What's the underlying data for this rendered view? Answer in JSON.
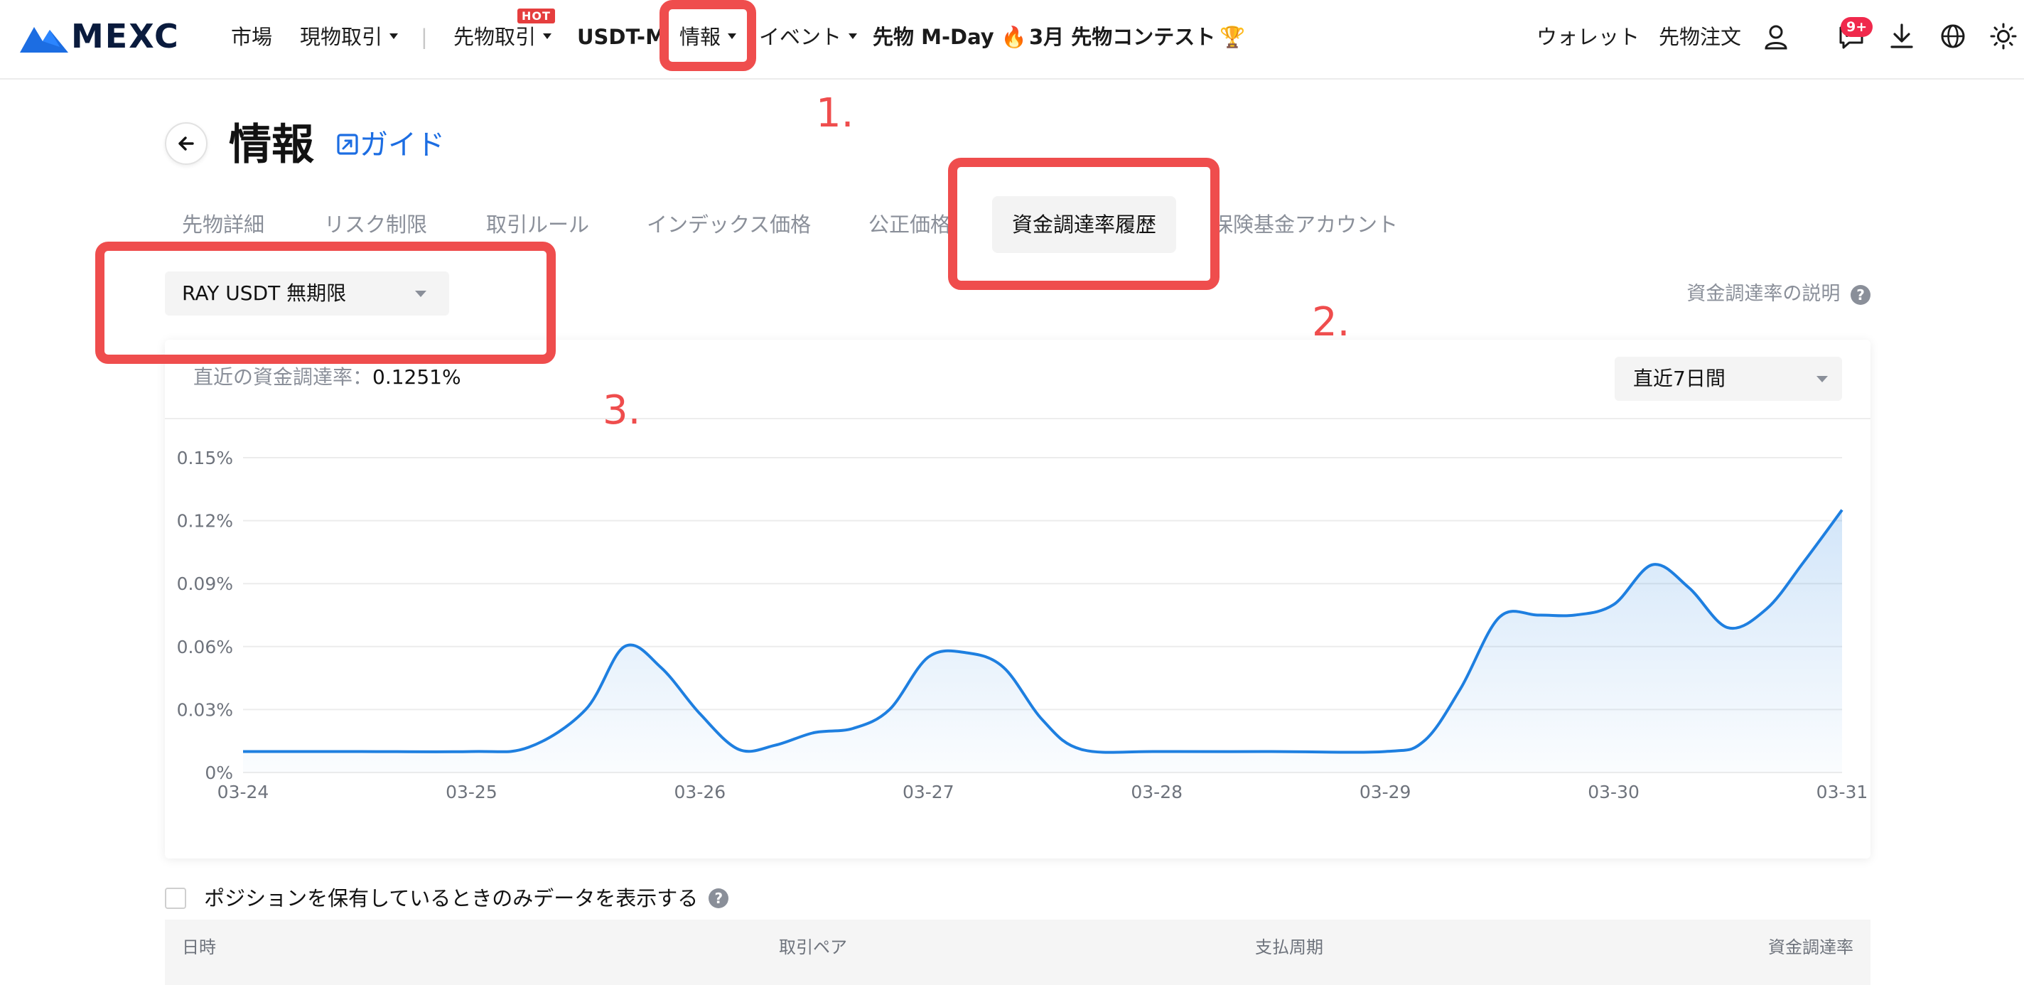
{
  "nav": {
    "logo": "MEXC",
    "items": [
      "市場",
      "現物取引",
      "先物取引",
      "USDT-M",
      "情報",
      "イベント",
      "先物 M-Day",
      "3月 先物コンテスト"
    ],
    "hot_badge": "HOT",
    "right_items": [
      "ウォレット",
      "先物注文"
    ],
    "notif_badge": "9+"
  },
  "page": {
    "title": "情報",
    "guide_link": "ガイド"
  },
  "tabs": [
    "先物詳細",
    "リスク制限",
    "取引ルール",
    "インデックス価格",
    "公正価格",
    "資金調達率履歴",
    "保険基金アカウント"
  ],
  "pair_select": {
    "value": "RAY USDT 無期限"
  },
  "explain_link": "資金調達率の説明",
  "latest_rate": {
    "label": "直近の資金調達率：",
    "value": "0.1251%"
  },
  "period_select": {
    "value": "直近7日間"
  },
  "annotations": [
    "1.",
    "2.",
    "3."
  ],
  "checkbox_label": "ポジションを保有しているときのみデータを表示する",
  "table_headers": [
    "日時",
    "取引ペア",
    "支払周期",
    "資金調達率"
  ],
  "colors": {
    "line": "#1e7fe0",
    "annotation": "#ef4d4d",
    "brand": "#1c6de2"
  },
  "chart_data": {
    "type": "area",
    "x_categories": [
      "03-24",
      "03-25",
      "03-26",
      "03-27",
      "03-28",
      "03-29",
      "03-30",
      "03-31"
    ],
    "y_ticks": [
      "0%",
      "0.03%",
      "0.06%",
      "0.09%",
      "0.12%",
      "0.15%"
    ],
    "ylim": [
      0,
      0.15
    ],
    "points": [
      {
        "t": 0.0,
        "v": 0.01
      },
      {
        "t": 0.5,
        "v": 0.01
      },
      {
        "t": 1.0,
        "v": 0.01
      },
      {
        "t": 1.25,
        "v": 0.012
      },
      {
        "t": 1.5,
        "v": 0.03
      },
      {
        "t": 1.67,
        "v": 0.06
      },
      {
        "t": 1.83,
        "v": 0.05
      },
      {
        "t": 2.0,
        "v": 0.028
      },
      {
        "t": 2.17,
        "v": 0.011
      },
      {
        "t": 2.33,
        "v": 0.013
      },
      {
        "t": 2.5,
        "v": 0.019
      },
      {
        "t": 2.67,
        "v": 0.021
      },
      {
        "t": 2.83,
        "v": 0.03
      },
      {
        "t": 3.0,
        "v": 0.055
      },
      {
        "t": 3.17,
        "v": 0.057
      },
      {
        "t": 3.33,
        "v": 0.05
      },
      {
        "t": 3.5,
        "v": 0.025
      },
      {
        "t": 3.67,
        "v": 0.011
      },
      {
        "t": 4.0,
        "v": 0.01
      },
      {
        "t": 4.5,
        "v": 0.01
      },
      {
        "t": 5.0,
        "v": 0.01
      },
      {
        "t": 5.17,
        "v": 0.015
      },
      {
        "t": 5.33,
        "v": 0.04
      },
      {
        "t": 5.5,
        "v": 0.074
      },
      {
        "t": 5.67,
        "v": 0.075
      },
      {
        "t": 5.83,
        "v": 0.075
      },
      {
        "t": 6.0,
        "v": 0.08
      },
      {
        "t": 6.17,
        "v": 0.099
      },
      {
        "t": 6.33,
        "v": 0.088
      },
      {
        "t": 6.5,
        "v": 0.069
      },
      {
        "t": 6.67,
        "v": 0.078
      },
      {
        "t": 6.83,
        "v": 0.1
      },
      {
        "t": 7.0,
        "v": 0.1251
      }
    ]
  }
}
